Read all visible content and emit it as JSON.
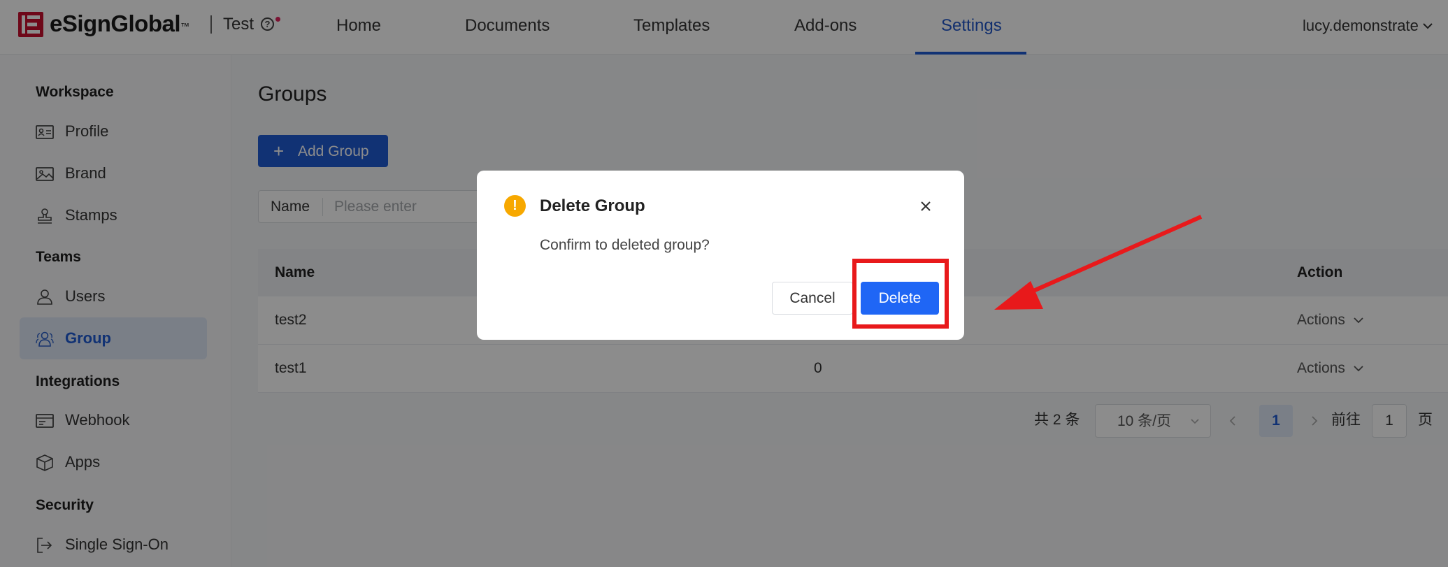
{
  "header": {
    "brand": "eSignGlobal",
    "brand_tm": "™",
    "workspace": "Test",
    "help_glyph": "?",
    "nav": [
      "Home",
      "Documents",
      "Templates",
      "Add-ons",
      "Settings"
    ],
    "active_nav": "Settings",
    "user": "lucy.demonstrate"
  },
  "sidebar": {
    "sections": {
      "workspace": "Workspace",
      "teams": "Teams",
      "integrations": "Integrations",
      "security": "Security"
    },
    "items": [
      {
        "label": "Profile",
        "icon": "profile-card-icon"
      },
      {
        "label": "Brand",
        "icon": "image-icon"
      },
      {
        "label": "Stamps",
        "icon": "stamp-icon"
      },
      {
        "label": "Users",
        "icon": "user-icon"
      },
      {
        "label": "Group",
        "icon": "users-group-icon"
      },
      {
        "label": "Webhook",
        "icon": "webhook-icon"
      },
      {
        "label": "Apps",
        "icon": "cube-icon"
      },
      {
        "label": "Single Sign-On",
        "icon": "sign-in-icon"
      }
    ],
    "active_item": "Group"
  },
  "main": {
    "title": "Groups",
    "add_button": "Add Group",
    "filter": {
      "label": "Name",
      "placeholder": "Please enter"
    },
    "table": {
      "headers": [
        "Name",
        "Action"
      ],
      "rows": [
        {
          "name": "test2",
          "count": "",
          "action": "Actions"
        },
        {
          "name": "test1",
          "count": "0",
          "action": "Actions"
        }
      ]
    },
    "pagination": {
      "total": "共 2 条",
      "page_size": "10 条/页",
      "current_page": "1",
      "goto_label": "前往",
      "goto_value": "1",
      "page_suffix": "页"
    }
  },
  "modal": {
    "title": "Delete Group",
    "message": "Confirm to deleted group?",
    "cancel": "Cancel",
    "confirm": "Delete",
    "warning_glyph": "!"
  },
  "colors": {
    "primary": "#1f5bd4",
    "delete_button": "#1f66f5",
    "warning": "#f7a800",
    "annotation_red": "#e8191b",
    "brand_red": "#c8102e"
  }
}
